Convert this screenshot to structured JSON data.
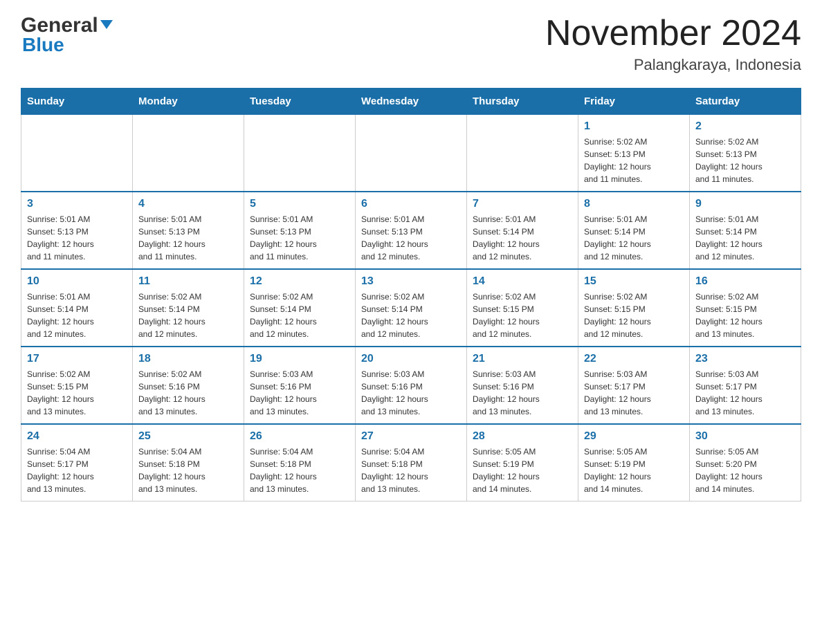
{
  "header": {
    "logo_general": "General",
    "logo_blue": "Blue",
    "month_title": "November 2024",
    "location": "Palangkaraya, Indonesia"
  },
  "weekdays": [
    "Sunday",
    "Monday",
    "Tuesday",
    "Wednesday",
    "Thursday",
    "Friday",
    "Saturday"
  ],
  "weeks": [
    {
      "days": [
        {
          "num": "",
          "info": ""
        },
        {
          "num": "",
          "info": ""
        },
        {
          "num": "",
          "info": ""
        },
        {
          "num": "",
          "info": ""
        },
        {
          "num": "",
          "info": ""
        },
        {
          "num": "1",
          "info": "Sunrise: 5:02 AM\nSunset: 5:13 PM\nDaylight: 12 hours\nand 11 minutes."
        },
        {
          "num": "2",
          "info": "Sunrise: 5:02 AM\nSunset: 5:13 PM\nDaylight: 12 hours\nand 11 minutes."
        }
      ]
    },
    {
      "days": [
        {
          "num": "3",
          "info": "Sunrise: 5:01 AM\nSunset: 5:13 PM\nDaylight: 12 hours\nand 11 minutes."
        },
        {
          "num": "4",
          "info": "Sunrise: 5:01 AM\nSunset: 5:13 PM\nDaylight: 12 hours\nand 11 minutes."
        },
        {
          "num": "5",
          "info": "Sunrise: 5:01 AM\nSunset: 5:13 PM\nDaylight: 12 hours\nand 11 minutes."
        },
        {
          "num": "6",
          "info": "Sunrise: 5:01 AM\nSunset: 5:13 PM\nDaylight: 12 hours\nand 12 minutes."
        },
        {
          "num": "7",
          "info": "Sunrise: 5:01 AM\nSunset: 5:14 PM\nDaylight: 12 hours\nand 12 minutes."
        },
        {
          "num": "8",
          "info": "Sunrise: 5:01 AM\nSunset: 5:14 PM\nDaylight: 12 hours\nand 12 minutes."
        },
        {
          "num": "9",
          "info": "Sunrise: 5:01 AM\nSunset: 5:14 PM\nDaylight: 12 hours\nand 12 minutes."
        }
      ]
    },
    {
      "days": [
        {
          "num": "10",
          "info": "Sunrise: 5:01 AM\nSunset: 5:14 PM\nDaylight: 12 hours\nand 12 minutes."
        },
        {
          "num": "11",
          "info": "Sunrise: 5:02 AM\nSunset: 5:14 PM\nDaylight: 12 hours\nand 12 minutes."
        },
        {
          "num": "12",
          "info": "Sunrise: 5:02 AM\nSunset: 5:14 PM\nDaylight: 12 hours\nand 12 minutes."
        },
        {
          "num": "13",
          "info": "Sunrise: 5:02 AM\nSunset: 5:14 PM\nDaylight: 12 hours\nand 12 minutes."
        },
        {
          "num": "14",
          "info": "Sunrise: 5:02 AM\nSunset: 5:15 PM\nDaylight: 12 hours\nand 12 minutes."
        },
        {
          "num": "15",
          "info": "Sunrise: 5:02 AM\nSunset: 5:15 PM\nDaylight: 12 hours\nand 12 minutes."
        },
        {
          "num": "16",
          "info": "Sunrise: 5:02 AM\nSunset: 5:15 PM\nDaylight: 12 hours\nand 13 minutes."
        }
      ]
    },
    {
      "days": [
        {
          "num": "17",
          "info": "Sunrise: 5:02 AM\nSunset: 5:15 PM\nDaylight: 12 hours\nand 13 minutes."
        },
        {
          "num": "18",
          "info": "Sunrise: 5:02 AM\nSunset: 5:16 PM\nDaylight: 12 hours\nand 13 minutes."
        },
        {
          "num": "19",
          "info": "Sunrise: 5:03 AM\nSunset: 5:16 PM\nDaylight: 12 hours\nand 13 minutes."
        },
        {
          "num": "20",
          "info": "Sunrise: 5:03 AM\nSunset: 5:16 PM\nDaylight: 12 hours\nand 13 minutes."
        },
        {
          "num": "21",
          "info": "Sunrise: 5:03 AM\nSunset: 5:16 PM\nDaylight: 12 hours\nand 13 minutes."
        },
        {
          "num": "22",
          "info": "Sunrise: 5:03 AM\nSunset: 5:17 PM\nDaylight: 12 hours\nand 13 minutes."
        },
        {
          "num": "23",
          "info": "Sunrise: 5:03 AM\nSunset: 5:17 PM\nDaylight: 12 hours\nand 13 minutes."
        }
      ]
    },
    {
      "days": [
        {
          "num": "24",
          "info": "Sunrise: 5:04 AM\nSunset: 5:17 PM\nDaylight: 12 hours\nand 13 minutes."
        },
        {
          "num": "25",
          "info": "Sunrise: 5:04 AM\nSunset: 5:18 PM\nDaylight: 12 hours\nand 13 minutes."
        },
        {
          "num": "26",
          "info": "Sunrise: 5:04 AM\nSunset: 5:18 PM\nDaylight: 12 hours\nand 13 minutes."
        },
        {
          "num": "27",
          "info": "Sunrise: 5:04 AM\nSunset: 5:18 PM\nDaylight: 12 hours\nand 13 minutes."
        },
        {
          "num": "28",
          "info": "Sunrise: 5:05 AM\nSunset: 5:19 PM\nDaylight: 12 hours\nand 14 minutes."
        },
        {
          "num": "29",
          "info": "Sunrise: 5:05 AM\nSunset: 5:19 PM\nDaylight: 12 hours\nand 14 minutes."
        },
        {
          "num": "30",
          "info": "Sunrise: 5:05 AM\nSunset: 5:20 PM\nDaylight: 12 hours\nand 14 minutes."
        }
      ]
    }
  ]
}
